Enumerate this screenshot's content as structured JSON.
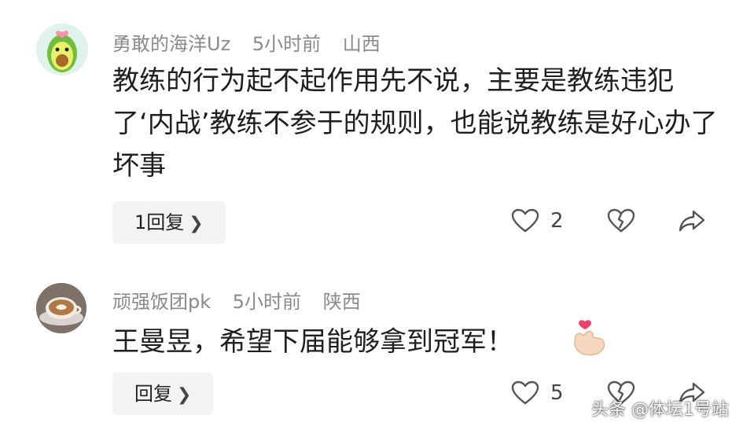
{
  "comments": [
    {
      "username": "勇敢的海洋Uz",
      "time": "5小时前",
      "location": "山西",
      "text": "教练的行为起不起作用先不说，主要是教练违犯了‘内战’教练不参于的规则，也能说教练是好心办了坏事",
      "reply_label": "1回复",
      "likes": "2",
      "avatar_icon": "avocado-avatar-icon"
    },
    {
      "username": "顽强饭团pk",
      "time": "5小时前",
      "location": "陕西",
      "text": "王曼昱，希望下届能够拿到冠军！",
      "reply_label": "回复",
      "likes": "5",
      "avatar_icon": "latte-cup-avatar-icon",
      "emoji": "finger-heart-emoji"
    }
  ],
  "watermark": "头条 @体坛1号站",
  "colors": {
    "meta": "#8a8a8a",
    "button_bg": "#f3f3f3",
    "icon": "#555555"
  }
}
